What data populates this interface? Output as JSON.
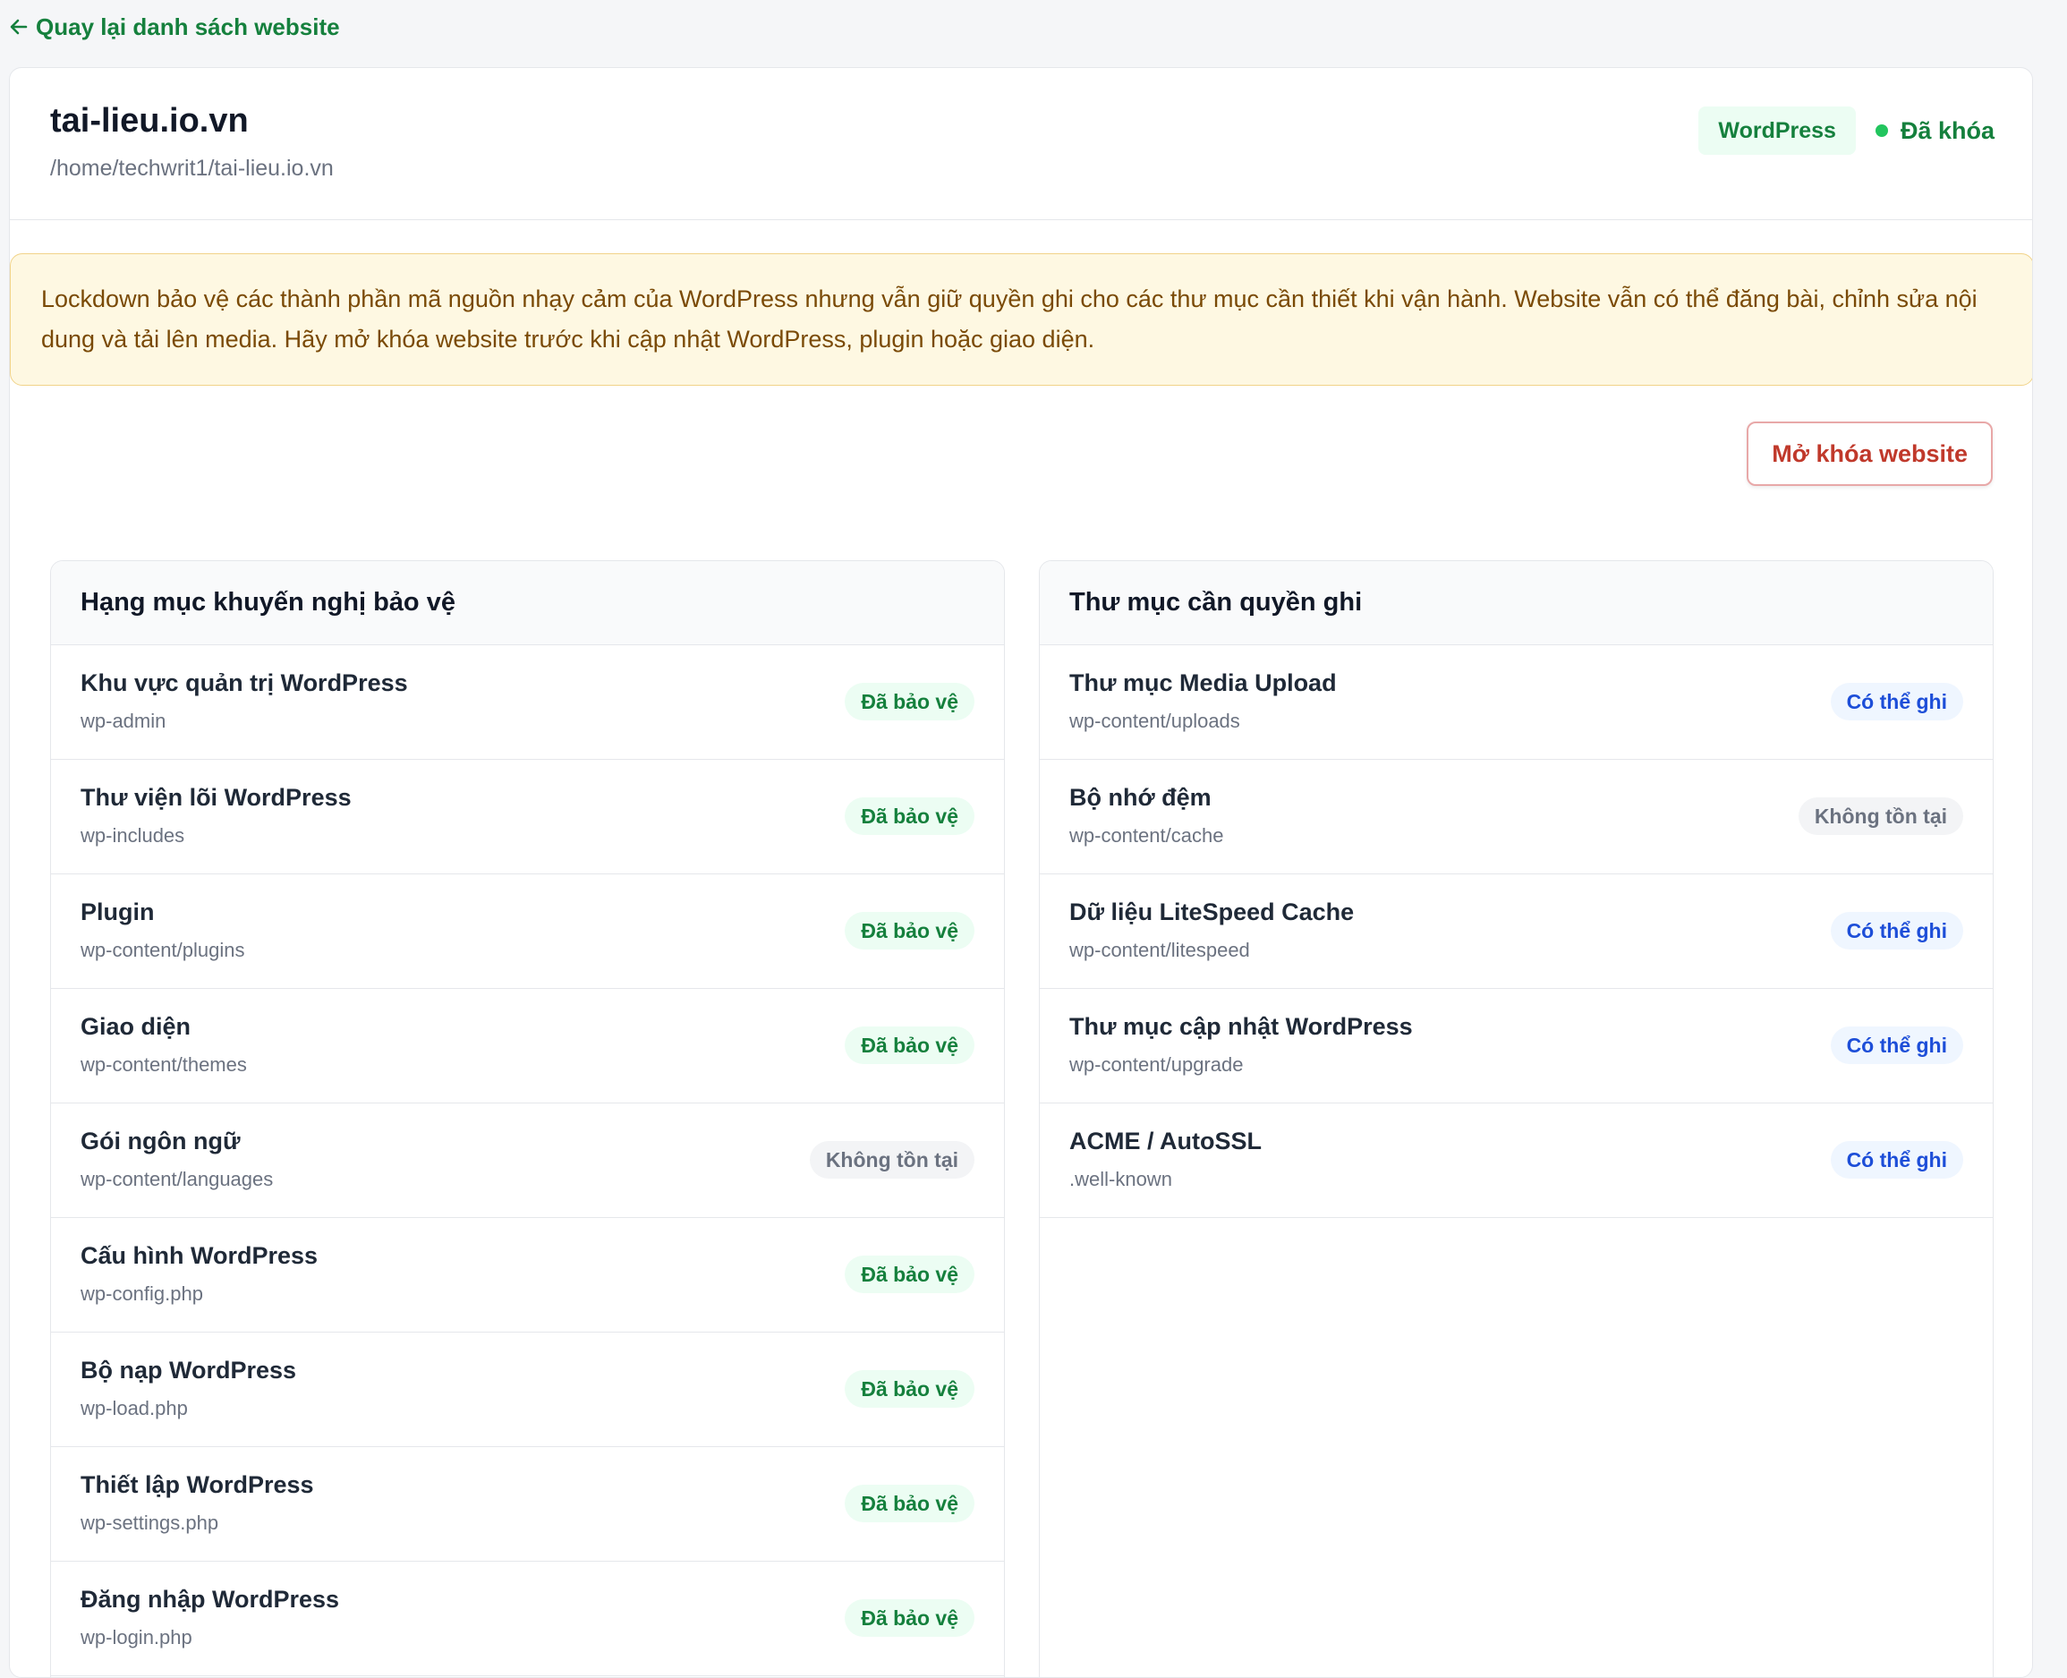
{
  "nav": {
    "back_label": "Quay lại danh sách website"
  },
  "site": {
    "title": "tai-lieu.io.vn",
    "path": "/home/techwrit1/tai-lieu.io.vn",
    "platform_badge": "WordPress",
    "lock_status": "Đã khóa"
  },
  "notice": {
    "text": "Lockdown bảo vệ các thành phần mã nguồn nhạy cảm của WordPress nhưng vẫn giữ quyền ghi cho các thư mục cần thiết khi vận hành. Website vẫn có thể đăng bài, chỉnh sửa nội dung và tải lên media. Hãy mở khóa website trước khi cập nhật WordPress, plugin hoặc giao diện."
  },
  "actions": {
    "unlock_label": "Mở khóa website"
  },
  "protected_panel": {
    "title": "Hạng mục khuyến nghị bảo vệ",
    "items": [
      {
        "title": "Khu vực quản trị WordPress",
        "path": "wp-admin",
        "status": "Đã bảo vệ",
        "kind": "protected"
      },
      {
        "title": "Thư viện lõi WordPress",
        "path": "wp-includes",
        "status": "Đã bảo vệ",
        "kind": "protected"
      },
      {
        "title": "Plugin",
        "path": "wp-content/plugins",
        "status": "Đã bảo vệ",
        "kind": "protected"
      },
      {
        "title": "Giao diện",
        "path": "wp-content/themes",
        "status": "Đã bảo vệ",
        "kind": "protected"
      },
      {
        "title": "Gói ngôn ngữ",
        "path": "wp-content/languages",
        "status": "Không tồn tại",
        "kind": "missing"
      },
      {
        "title": "Cấu hình WordPress",
        "path": "wp-config.php",
        "status": "Đã bảo vệ",
        "kind": "protected"
      },
      {
        "title": "Bộ nạp WordPress",
        "path": "wp-load.php",
        "status": "Đã bảo vệ",
        "kind": "protected"
      },
      {
        "title": "Thiết lập WordPress",
        "path": "wp-settings.php",
        "status": "Đã bảo vệ",
        "kind": "protected"
      },
      {
        "title": "Đăng nhập WordPress",
        "path": "wp-login.php",
        "status": "Đã bảo vệ",
        "kind": "protected"
      }
    ]
  },
  "writable_panel": {
    "title": "Thư mục cần quyền ghi",
    "items": [
      {
        "title": "Thư mục Media Upload",
        "path": "wp-content/uploads",
        "status": "Có thể ghi",
        "kind": "writable"
      },
      {
        "title": "Bộ nhớ đệm",
        "path": "wp-content/cache",
        "status": "Không tồn tại",
        "kind": "missing"
      },
      {
        "title": "Dữ liệu LiteSpeed Cache",
        "path": "wp-content/litespeed",
        "status": "Có thể ghi",
        "kind": "writable"
      },
      {
        "title": "Thư mục cập nhật WordPress",
        "path": "wp-content/upgrade",
        "status": "Có thể ghi",
        "kind": "writable"
      },
      {
        "title": "ACME / AutoSSL",
        "path": ".well-known",
        "status": "Có thể ghi",
        "kind": "writable"
      }
    ]
  },
  "colors": {
    "accent_green": "#15803d",
    "status_dot": "#22c55e",
    "danger": "#c0392b",
    "writable_blue": "#1d4ed8",
    "notice_bg": "#fef8e2"
  }
}
